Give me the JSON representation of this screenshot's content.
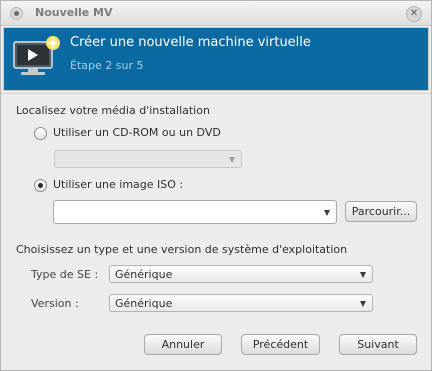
{
  "window": {
    "title": "Nouvelle MV"
  },
  "header": {
    "title": "Créer une nouvelle machine virtuelle",
    "step": "Étape 2 sur 5"
  },
  "media": {
    "section_label": "Localisez votre média d'installation",
    "cdrom_option": "Utiliser un CD-ROM ou un DVD",
    "cdrom_selected": false,
    "cdrom_device": "",
    "iso_option": "Utiliser une image ISO :",
    "iso_selected": true,
    "iso_path": "",
    "browse_button": "Parcourir..."
  },
  "os": {
    "section_label": "Choisissez un type et une version de système d'exploitation",
    "type_label": "Type de SE :",
    "type_value": "Générique",
    "version_label": "Version :",
    "version_value": "Générique"
  },
  "buttons": {
    "cancel": "Annuler",
    "back": "Précédent",
    "next": "Suivant"
  },
  "colors": {
    "header_background": "#0b6aa2",
    "header_title": "#ffffff",
    "header_step": "#a9d1ec"
  }
}
